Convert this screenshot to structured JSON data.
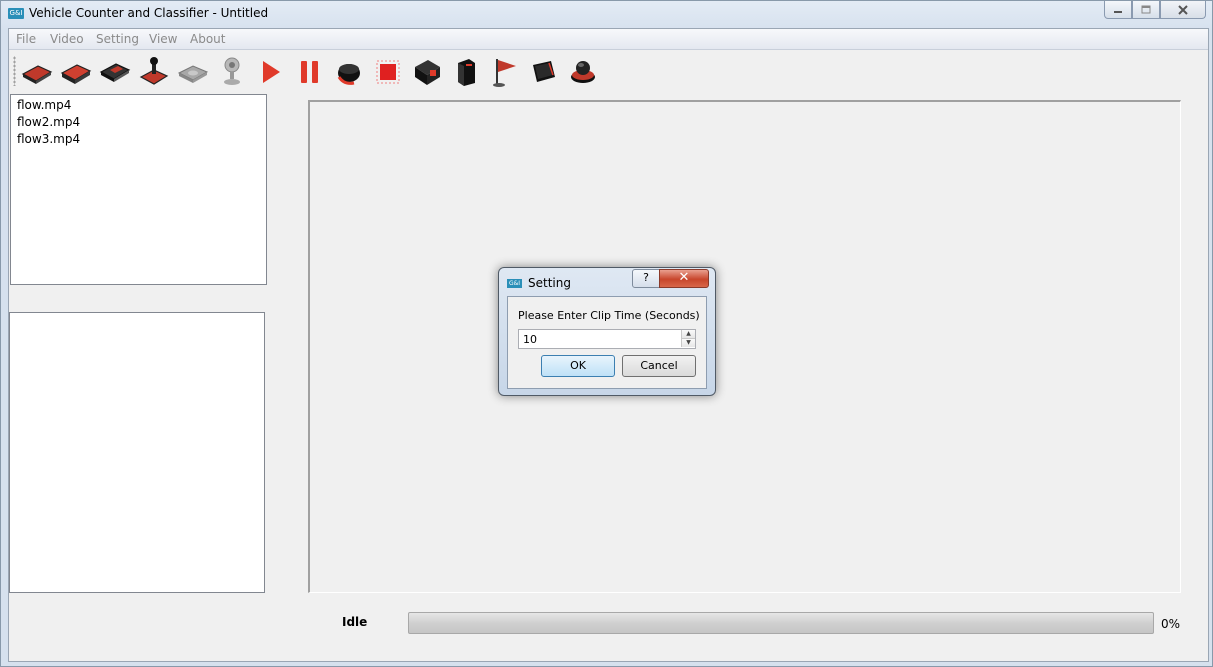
{
  "window": {
    "app_icon": "G&I",
    "title": "Vehicle Counter and Classifier - Untitled",
    "minimize_icon": "minimize-icon",
    "maximize_icon": "maximize-icon",
    "close_icon": "close-icon"
  },
  "menu": {
    "items": [
      "File",
      "Video",
      "Setting",
      "View",
      "About"
    ]
  },
  "toolbar": {
    "icons": [
      "open-file-icon",
      "open-folder-icon",
      "save-icon",
      "joystick-icon",
      "disk-icon",
      "webcam-icon",
      "play-icon",
      "pause-icon",
      "record-icon",
      "stop-icon",
      "settings-chip-icon",
      "device-icon",
      "flag-icon",
      "monitor-icon",
      "exit-icon"
    ]
  },
  "file_list": {
    "items": [
      "flow.mp4",
      "flow2.mp4",
      "flow3.mp4"
    ]
  },
  "status": {
    "label": "Idle",
    "progress": 0,
    "progress_text": "0%"
  },
  "dialog": {
    "app_icon": "G&I",
    "title": "Setting",
    "help_label": "?",
    "close_label": "✕",
    "prompt": "Please Enter Clip Time (Seconds)",
    "value": "10",
    "ok_label": "OK",
    "cancel_label": "Cancel"
  },
  "colors": {
    "accent_red": "#c0392b",
    "dialog_close": "#c8462c",
    "ok_border": "#3c7fb1"
  }
}
